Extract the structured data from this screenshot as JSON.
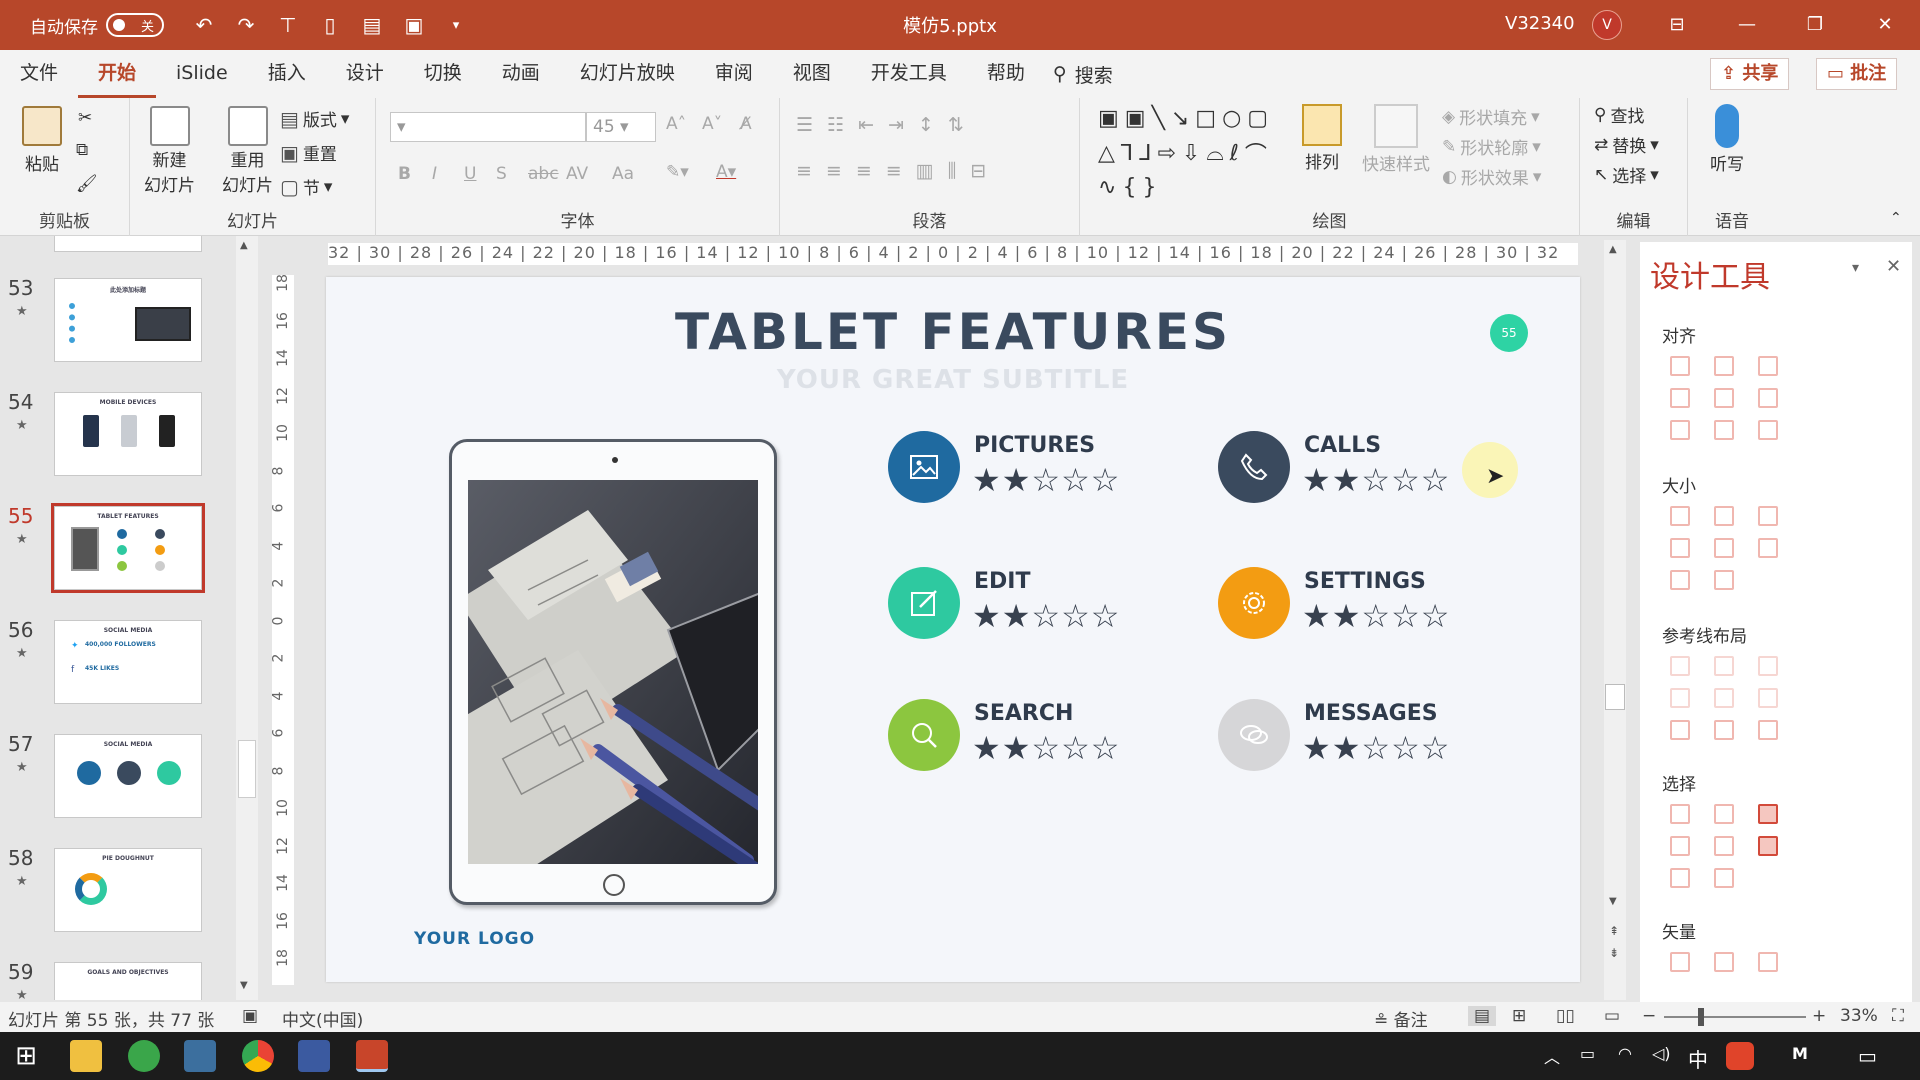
{
  "titlebar": {
    "autosave_label": "自动保存",
    "autosave_state": "关",
    "filename": "模仿5.pptx",
    "user": "V32340",
    "avatar_initial": "V"
  },
  "menu": {
    "tabs": [
      "文件",
      "开始",
      "iSlide",
      "插入",
      "设计",
      "切换",
      "动画",
      "幻灯片放映",
      "审阅",
      "视图",
      "开发工具",
      "帮助"
    ],
    "active_tab": "开始",
    "search_label": "搜索",
    "share_label": "共享",
    "comment_label": "批注"
  },
  "ribbon": {
    "clipboard": {
      "label": "剪贴板",
      "paste": "粘贴"
    },
    "slides": {
      "label": "幻灯片",
      "new_slide_1": "新建",
      "new_slide_2": "幻灯片",
      "reuse_1": "重用",
      "reuse_2": "幻灯片",
      "layout": "版式",
      "reset": "重置",
      "section": "节"
    },
    "font": {
      "label": "字体",
      "size": "45",
      "bold": "B",
      "italic": "I",
      "underline": "U",
      "strike": "S",
      "abc": "abc",
      "av": "AV",
      "aa": "Aa"
    },
    "paragraph": {
      "label": "段落"
    },
    "drawing": {
      "label": "绘图",
      "arrange": "排列",
      "quick_styles": "快速样式",
      "shape_fill": "形状填充",
      "shape_outline": "形状轮廓",
      "shape_effects": "形状效果"
    },
    "editing": {
      "label": "编辑",
      "find": "查找",
      "replace": "替换",
      "select": "选择"
    },
    "voice": {
      "label": "语音",
      "dictate": "听写"
    }
  },
  "rulers": {
    "horizontal": "32 | 30 | 28 | 26 | 24 | 22 | 20 | 18 | 16 | 14 | 12 | 10 | 8 | 6 | 4 | 2 | 0 | 2 | 4 | 6 | 8 | 10 | 12 | 14 | 16 | 18 | 20 | 22 | 24 | 26 | 28 | 30 | 32",
    "vertical": [
      "18",
      "16",
      "14",
      "12",
      "10",
      "8",
      "6",
      "4",
      "2",
      "0",
      "2",
      "4",
      "6",
      "8",
      "10",
      "12",
      "14",
      "16",
      "18"
    ]
  },
  "thumbnails": [
    {
      "num": "53",
      "title": "此处添加标题"
    },
    {
      "num": "54",
      "title": "MOBILE DEVICES"
    },
    {
      "num": "55",
      "title": "TABLET FEATURES",
      "active": true
    },
    {
      "num": "56",
      "title": "SOCIAL MEDIA"
    },
    {
      "num": "57",
      "title": "SOCIAL MEDIA"
    },
    {
      "num": "58",
      "title": "PIE DOUGHNUT"
    },
    {
      "num": "59",
      "title": "GOALS AND OBJECTIVES"
    }
  ],
  "thumb_details": {
    "s56_followers": "400,000 FOLLOWERS",
    "s56_likes": "45K LIKES"
  },
  "slide": {
    "title": "TABLET FEATURES",
    "subtitle": "YOUR GREAT SUBTITLE",
    "page_badge": "55",
    "logo": "YOUR LOGO",
    "features": [
      {
        "name": "PICTURES",
        "icon": "image-icon",
        "color": "#1f6aa0",
        "rating": 2,
        "max": 5
      },
      {
        "name": "CALLS",
        "icon": "phone-icon",
        "color": "#3a4a5e",
        "rating": 2,
        "max": 5
      },
      {
        "name": "EDIT",
        "icon": "edit-icon",
        "color": "#2ec9a0",
        "rating": 2,
        "max": 5
      },
      {
        "name": "SETTINGS",
        "icon": "gear-icon",
        "color": "#f39c12",
        "rating": 2,
        "max": 5
      },
      {
        "name": "SEARCH",
        "icon": "search-icon",
        "color": "#8cc63f",
        "rating": 2,
        "max": 5
      },
      {
        "name": "MESSAGES",
        "icon": "chat-icon",
        "color": "#d6d6d8",
        "rating": 2,
        "max": 5
      }
    ]
  },
  "panel": {
    "title": "设计工具",
    "sections": [
      "对齐",
      "大小",
      "参考线布局",
      "选择",
      "矢量"
    ]
  },
  "statusbar": {
    "slide_info": "幻灯片 第 55 张，共 77 张",
    "language": "中文(中国)",
    "notes": "备注",
    "zoom": "33%"
  },
  "taskbar": {
    "ime": "中"
  }
}
